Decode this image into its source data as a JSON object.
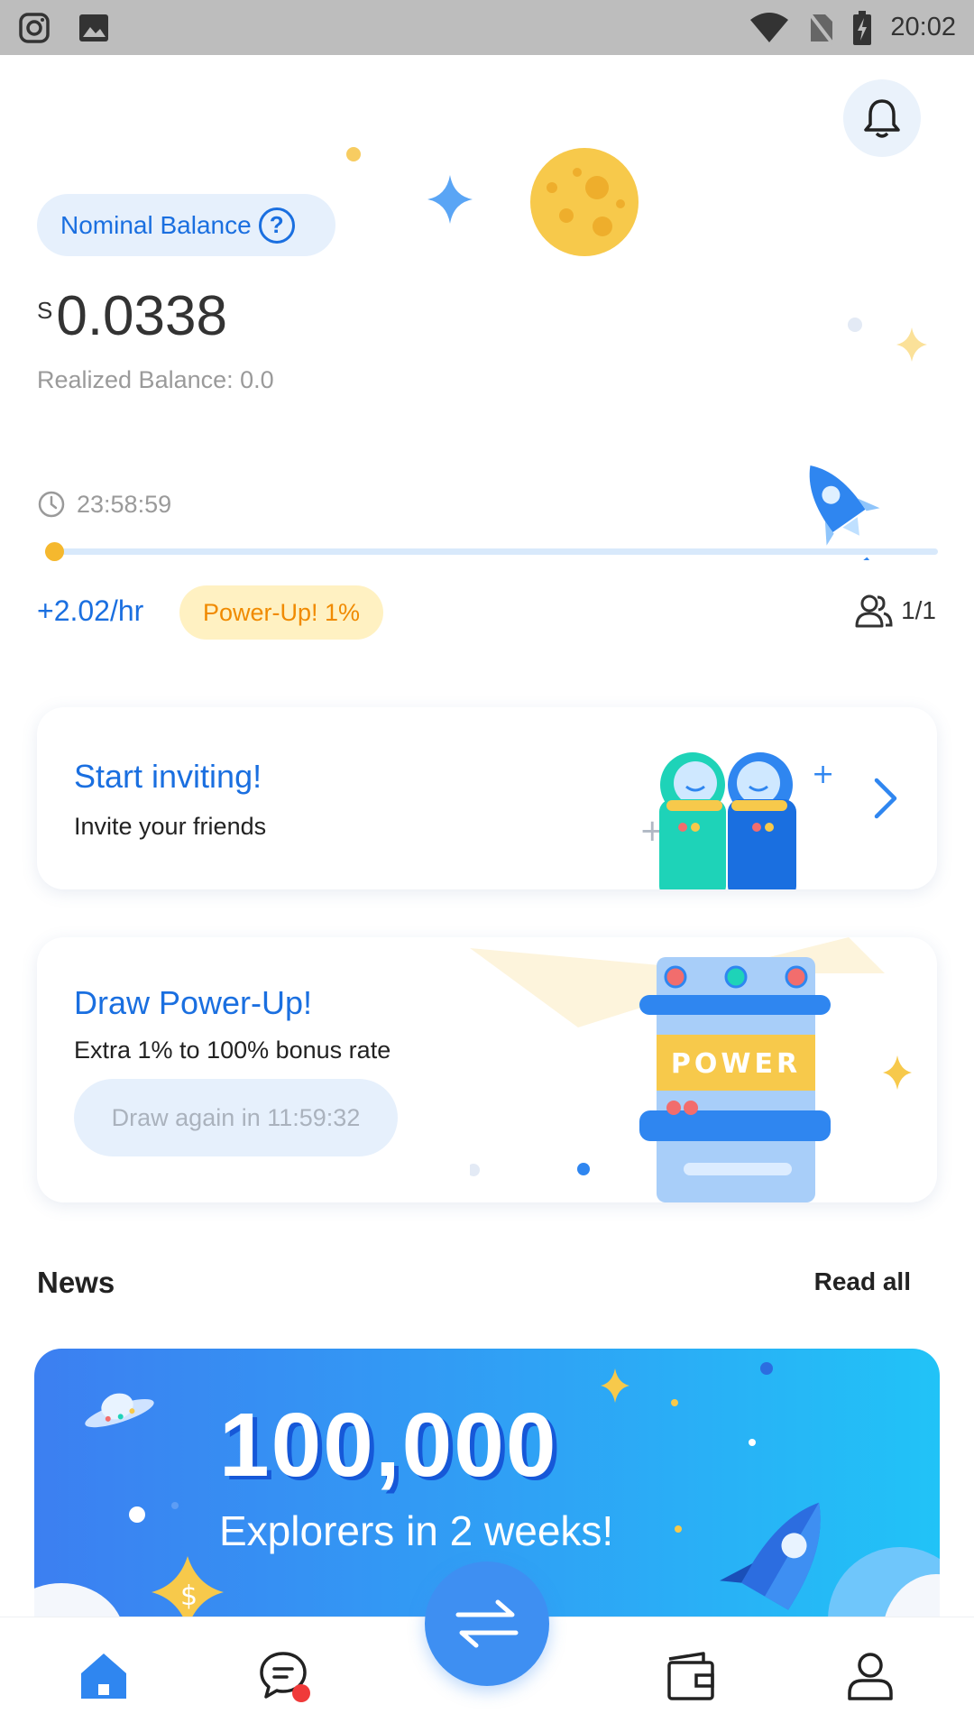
{
  "status_bar": {
    "time": "20:02"
  },
  "balance": {
    "label": "Nominal Balance",
    "help": "?",
    "currency": "S",
    "amount": "0.0338",
    "realized": "Realized Balance: 0.0"
  },
  "mining": {
    "timer": "23:58:59",
    "progress": 0.01,
    "rate": "+2.02/hr",
    "powerup_badge": "Power-Up! 1%",
    "friends": "1/1"
  },
  "invite_card": {
    "title": "Start inviting!",
    "subtitle": "Invite your friends"
  },
  "powerup_card": {
    "title": "Draw Power-Up!",
    "subtitle": "Extra 1% to 100% bonus rate",
    "button": "Draw again in 11:59:32",
    "machine_label": "POWER"
  },
  "news": {
    "title": "News",
    "read_all": "Read all",
    "banner_big": "100,000",
    "banner_sub": "Explorers in 2 weeks!"
  },
  "nav": {
    "active": "home",
    "items": [
      "home-icon",
      "chat-icon",
      "exchange-icon",
      "wallet-icon",
      "profile-icon"
    ]
  },
  "colors": {
    "accent": "#1a6fe0",
    "highlight": "#f5b82e",
    "powerup": "#f08a00"
  }
}
